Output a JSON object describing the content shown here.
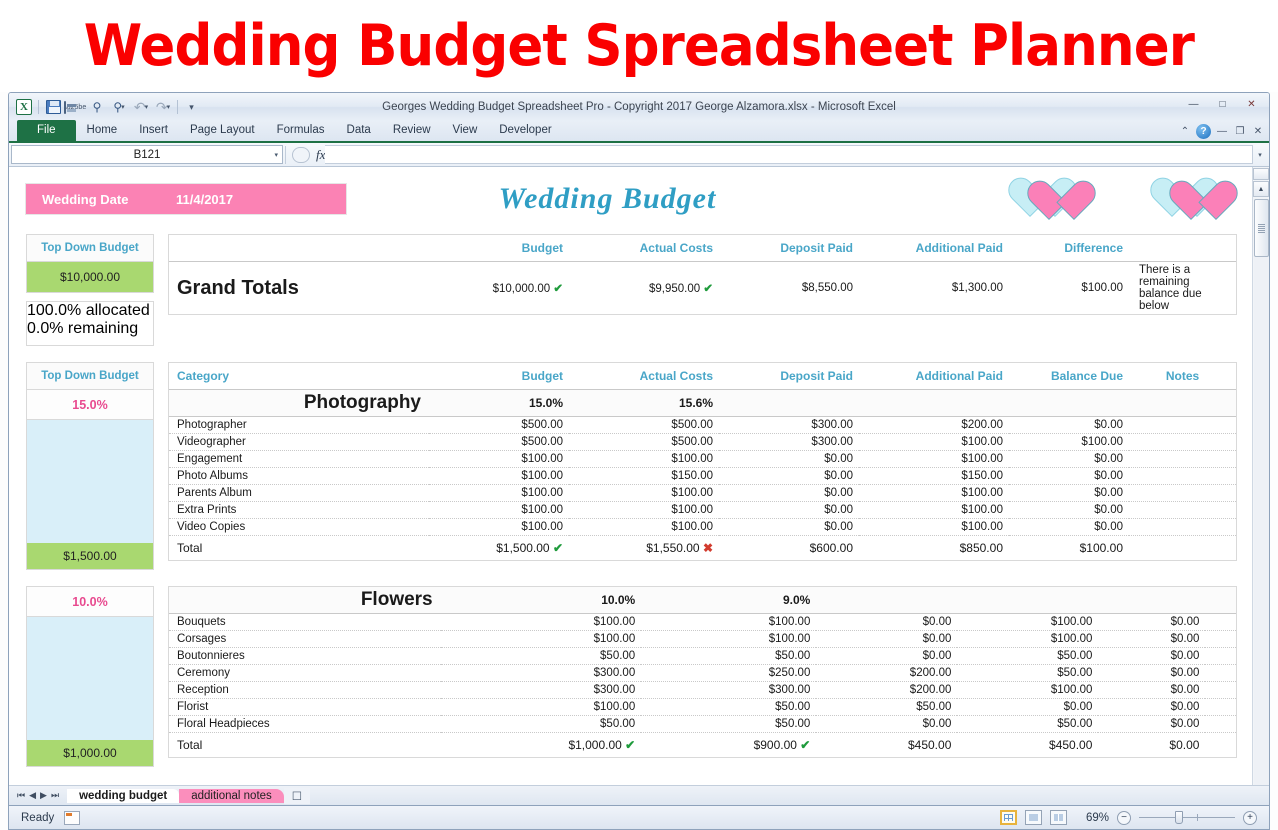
{
  "banner": {
    "title": "Wedding Budget Spreadsheet Planner"
  },
  "window": {
    "title": "Georges Wedding Budget Spreadsheet Pro - Copyright 2017 George Alzamora.xlsx  -  Microsoft Excel",
    "minimize": "—",
    "restore": "□",
    "close": "✕",
    "ribbon_collapse": "⌃",
    "help": "?",
    "ribbon_min": "—",
    "ribbon_restore": "❐",
    "ribbon_close": "✕"
  },
  "qat": {
    "logo": "X",
    "items": [
      {
        "name": "save-icon",
        "label": "Save"
      },
      {
        "name": "print-preview-icon",
        "label": "Print Preview"
      },
      {
        "name": "find-icon",
        "label": "Find"
      },
      {
        "name": "find-options-icon",
        "label": "Find Options"
      },
      {
        "name": "undo-icon",
        "label": "↶"
      },
      {
        "name": "redo-icon",
        "label": "↷"
      },
      {
        "name": "customize-qat-icon",
        "label": "▾"
      }
    ]
  },
  "ribbon": {
    "tabs": [
      "File",
      "Home",
      "Insert",
      "Page Layout",
      "Formulas",
      "Data",
      "Review",
      "View",
      "Developer"
    ]
  },
  "formula_bar": {
    "name_box": "B121",
    "fx_label": "fx",
    "formula_value": ""
  },
  "sheet": {
    "wedding_date": {
      "label": "Wedding Date",
      "value": "11/4/2017"
    },
    "title": "Wedding Budget",
    "grand": {
      "side_header": "Top Down Budget",
      "side_budget": "$10,000.00",
      "allocated": "100.0%  allocated",
      "remaining": "0.0%  remaining",
      "columns": [
        "",
        "Budget",
        "Actual Costs",
        "Deposit Paid",
        "Additional Paid",
        "Difference",
        ""
      ],
      "label": "Grand Totals",
      "budget": "$10,000.00",
      "budget_mark": "✔",
      "actual": "$9,950.00",
      "actual_mark": "✔",
      "deposit": "$8,550.00",
      "additional": "$1,300.00",
      "difference": "$100.00",
      "note": "There is a remaining balance due below"
    },
    "table_columns": [
      "Category",
      "Budget",
      "Actual Costs",
      "Deposit Paid",
      "Additional Paid",
      "Balance Due",
      "Notes"
    ],
    "sections": [
      {
        "side_header": "Top Down Budget",
        "side_pct": "15.0%",
        "side_total": "$1,500.00",
        "name": "Photography",
        "budget_pct": "15.0%",
        "actual_pct": "15.6%",
        "rows": [
          {
            "category": "Photographer",
            "budget": "$500.00",
            "actual": "$500.00",
            "deposit": "$300.00",
            "additional": "$200.00",
            "balance": "$0.00",
            "balance_red": false,
            "notes": ""
          },
          {
            "category": "Videographer",
            "budget": "$500.00",
            "actual": "$500.00",
            "deposit": "$300.00",
            "additional": "$100.00",
            "balance": "$100.00",
            "balance_red": true,
            "notes": ""
          },
          {
            "category": "Engagement",
            "budget": "$100.00",
            "actual": "$100.00",
            "deposit": "$0.00",
            "additional": "$100.00",
            "balance": "$0.00",
            "balance_red": false,
            "notes": ""
          },
          {
            "category": "Photo Albums",
            "budget": "$100.00",
            "actual": "$150.00",
            "deposit": "$0.00",
            "additional": "$150.00",
            "balance": "$0.00",
            "balance_red": false,
            "notes": ""
          },
          {
            "category": "Parents Album",
            "budget": "$100.00",
            "actual": "$100.00",
            "deposit": "$0.00",
            "additional": "$100.00",
            "balance": "$0.00",
            "balance_red": false,
            "notes": ""
          },
          {
            "category": "Extra Prints",
            "budget": "$100.00",
            "actual": "$100.00",
            "deposit": "$0.00",
            "additional": "$100.00",
            "balance": "$0.00",
            "balance_red": false,
            "notes": ""
          },
          {
            "category": "Video Copies",
            "budget": "$100.00",
            "actual": "$100.00",
            "deposit": "$0.00",
            "additional": "$100.00",
            "balance": "$0.00",
            "balance_red": false,
            "notes": ""
          }
        ],
        "total": {
          "label": "Total",
          "budget": "$1,500.00",
          "budget_mark": "✔",
          "budget_ok": true,
          "actual": "$1,550.00",
          "actual_mark": "✖",
          "actual_ok": false,
          "deposit": "$600.00",
          "additional": "$850.00",
          "balance": "$100.00",
          "balance_red": true,
          "notes": ""
        }
      },
      {
        "side_header": "",
        "side_pct": "10.0%",
        "side_total": "$1,000.00",
        "name": "Flowers",
        "budget_pct": "10.0%",
        "actual_pct": "9.0%",
        "rows": [
          {
            "category": "Bouquets",
            "budget": "$100.00",
            "actual": "$100.00",
            "deposit": "$0.00",
            "additional": "$100.00",
            "balance": "$0.00",
            "balance_red": false,
            "notes": ""
          },
          {
            "category": "Corsages",
            "budget": "$100.00",
            "actual": "$100.00",
            "deposit": "$0.00",
            "additional": "$100.00",
            "balance": "$0.00",
            "balance_red": false,
            "notes": ""
          },
          {
            "category": "Boutonnieres",
            "budget": "$50.00",
            "actual": "$50.00",
            "deposit": "$0.00",
            "additional": "$50.00",
            "balance": "$0.00",
            "balance_red": false,
            "notes": ""
          },
          {
            "category": "Ceremony",
            "budget": "$300.00",
            "actual": "$250.00",
            "deposit": "$200.00",
            "additional": "$50.00",
            "balance": "$0.00",
            "balance_red": false,
            "notes": ""
          },
          {
            "category": "Reception",
            "budget": "$300.00",
            "actual": "$300.00",
            "deposit": "$200.00",
            "additional": "$100.00",
            "balance": "$0.00",
            "balance_red": false,
            "notes": ""
          },
          {
            "category": "Florist",
            "budget": "$100.00",
            "actual": "$50.00",
            "deposit": "$50.00",
            "additional": "$0.00",
            "balance": "$0.00",
            "balance_red": false,
            "notes": ""
          },
          {
            "category": "Floral Headpieces",
            "budget": "$50.00",
            "actual": "$50.00",
            "deposit": "$0.00",
            "additional": "$50.00",
            "balance": "$0.00",
            "balance_red": false,
            "notes": ""
          }
        ],
        "total": {
          "label": "Total",
          "budget": "$1,000.00",
          "budget_mark": "✔",
          "budget_ok": true,
          "actual": "$900.00",
          "actual_mark": "✔",
          "actual_ok": true,
          "deposit": "$450.00",
          "additional": "$450.00",
          "balance": "$0.00",
          "balance_red": false,
          "notes": ""
        }
      }
    ]
  },
  "sheet_tabs": {
    "nav": [
      "⏮",
      "◀",
      "▶",
      "⏭"
    ],
    "tabs": [
      {
        "label": "wedding budget",
        "state": "active"
      },
      {
        "label": "additional notes",
        "state": "pink"
      }
    ],
    "new_sheet": "➕"
  },
  "status": {
    "ready": "Ready",
    "zoom": "69%",
    "zoom_out": "−",
    "zoom_in": "+",
    "views": [
      "normal-view",
      "page-layout-view",
      "page-break-view"
    ]
  },
  "colors": {
    "banner_red": "#fa0000",
    "pink": "#fb82b4",
    "hot_pink": "#ee4f95",
    "teal": "#49a6c8",
    "green": "#a9d870",
    "blue_fill": "#d9eff9",
    "red_text": "#e62222",
    "excel_green": "#1e7145"
  }
}
